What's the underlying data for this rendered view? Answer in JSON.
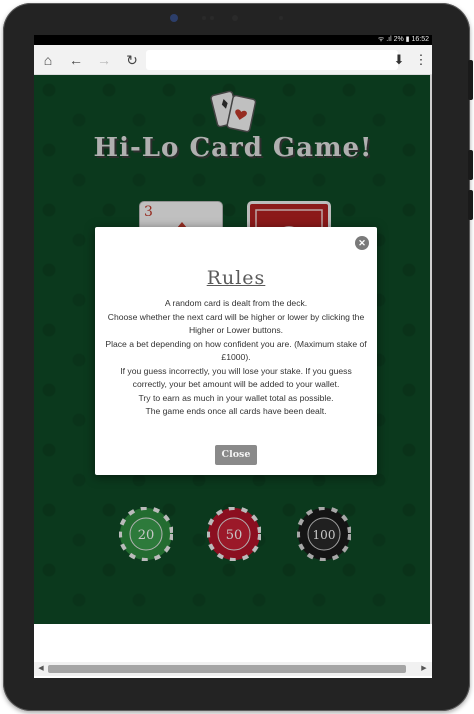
{
  "status_bar": {
    "text": "ᯤ .ıl 2% ▮ 16:52"
  },
  "toolbar": {
    "home_icon": "home-icon",
    "back_icon": "back-arrow-icon",
    "forward_icon": "forward-arrow-icon",
    "reload_icon": "reload-icon",
    "url_value": "",
    "download_icon": "download-icon",
    "menu_icon": "more-vert-icon"
  },
  "game": {
    "title": "Hi-Lo Card Game!",
    "current_card": {
      "rank": "3",
      "suit": "diamonds"
    },
    "chips": [
      {
        "value": "20",
        "color": "#2e8b3e"
      },
      {
        "value": "50",
        "color": "#b3142a"
      },
      {
        "value": "100",
        "color": "#1a1a1a"
      }
    ]
  },
  "modal": {
    "title": "Rules",
    "rules": [
      "A random card is dealt from the deck.",
      "Choose whether the next card will be higher or lower by clicking the Higher or Lower buttons.",
      "Place a bet depending on how confident you are. (Maximum stake of £1000).",
      "If you guess incorrectly, you will lose your stake. If you guess correctly, your bet amount will be added to your wallet.",
      "Try to earn as much in your wallet total as possible.",
      "The game ends once all cards have been dealt."
    ],
    "close_label": "Close"
  },
  "colors": {
    "felt": "#0f4a26",
    "modal_button": "#8a8a8a",
    "device_frame": "#232323"
  }
}
